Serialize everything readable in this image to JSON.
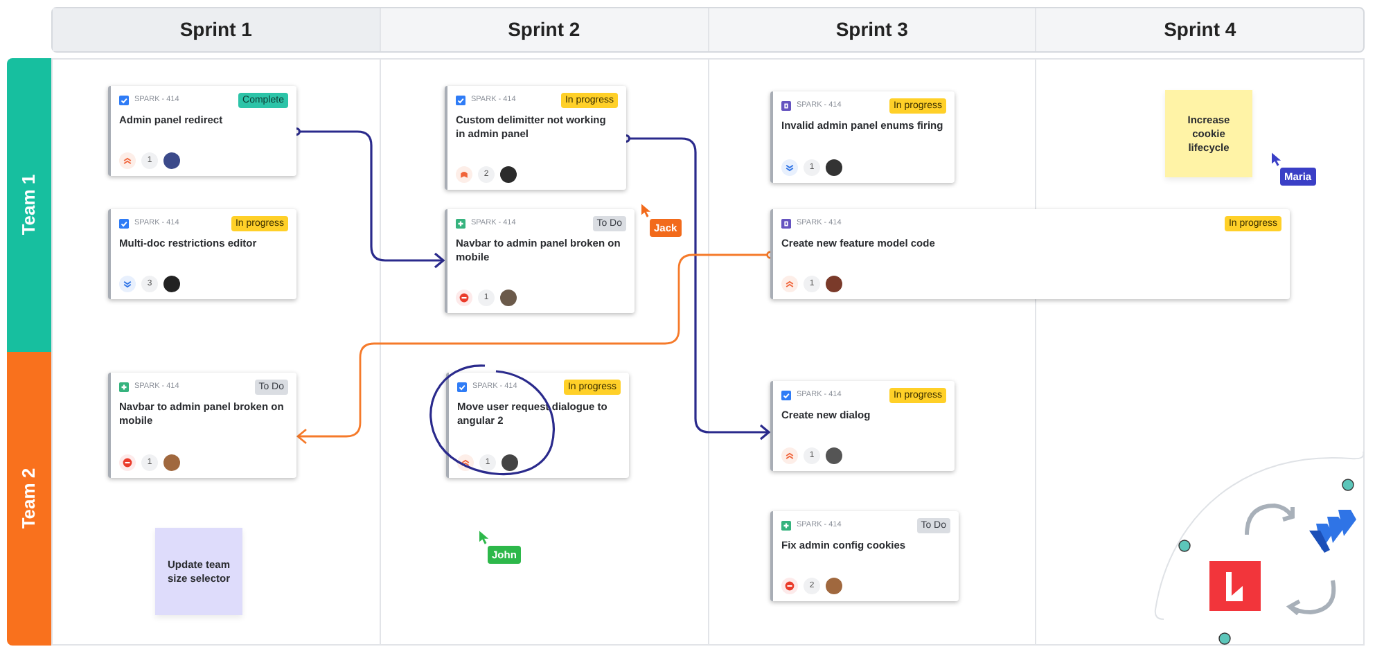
{
  "board": {
    "columns": [
      {
        "title": "Sprint 1"
      },
      {
        "title": "Sprint 2"
      },
      {
        "title": "Sprint 3"
      },
      {
        "title": "Sprint 4"
      }
    ],
    "lanes": [
      {
        "title": "Team 1",
        "color": "#17bf9f"
      },
      {
        "title": "Team 2",
        "color": "#f9711d"
      }
    ]
  },
  "cards": [
    {
      "key": "SPARK - 414",
      "title": "Admin panel redirect",
      "type": {
        "kind": "task"
      },
      "status": {
        "text": "Complete",
        "kind": "complete"
      },
      "priority": {
        "kind": "highest"
      },
      "count": "1"
    },
    {
      "key": "SPARK - 414",
      "title": "Multi-doc restrictions editor",
      "type": {
        "kind": "task"
      },
      "status": {
        "text": "In progress",
        "kind": "progress"
      },
      "priority": {
        "kind": "lowest"
      },
      "count": "3"
    },
    {
      "key": "SPARK - 414",
      "title": "Custom delimitter not working in admin panel",
      "type": {
        "kind": "task"
      },
      "status": {
        "text": "In progress",
        "kind": "progress"
      },
      "priority": {
        "kind": "critical"
      },
      "count": "2"
    },
    {
      "key": "SPARK - 414",
      "title": "Navbar to admin panel broken on mobile",
      "type": {
        "kind": "story"
      },
      "status": {
        "text": "To Do",
        "kind": "todo"
      },
      "priority": {
        "kind": "blocker"
      },
      "count": "1"
    },
    {
      "key": "SPARK - 414",
      "title": "Navbar to admin panel broken on mobile",
      "type": {
        "kind": "story"
      },
      "status": {
        "text": "To Do",
        "kind": "todo"
      },
      "priority": {
        "kind": "blocker"
      },
      "count": "1"
    },
    {
      "key": "SPARK - 414",
      "title": "Move user request dialogue to angular 2",
      "type": {
        "kind": "task"
      },
      "status": {
        "text": "In progress",
        "kind": "progress"
      },
      "priority": {
        "kind": "highest"
      },
      "count": "1"
    },
    {
      "key": "SPARK - 414",
      "title": "Invalid admin panel enums firing",
      "type": {
        "kind": "subtask"
      },
      "status": {
        "text": "In progress",
        "kind": "progress"
      },
      "priority": {
        "kind": "lowest"
      },
      "count": "1"
    },
    {
      "key": "SPARK - 414",
      "title": "Create new feature model code",
      "type": {
        "kind": "subtask"
      },
      "status": {
        "text": "In progress",
        "kind": "progress"
      },
      "priority": {
        "kind": "highest"
      },
      "count": "1"
    },
    {
      "key": "SPARK - 414",
      "title": "Create new dialog",
      "type": {
        "kind": "task"
      },
      "status": {
        "text": "In progress",
        "kind": "progress"
      },
      "priority": {
        "kind": "highest"
      },
      "count": "1"
    },
    {
      "key": "SPARK - 414",
      "title": "Fix admin config cookies",
      "type": {
        "kind": "story"
      },
      "status": {
        "text": "To Do",
        "kind": "todo"
      },
      "priority": {
        "kind": "blocker"
      },
      "count": "2"
    }
  ],
  "sticky_notes": [
    {
      "text": "Increase cookie lifecycle",
      "color": "#fff3a6"
    },
    {
      "text": "Update team size selector",
      "color": "#dedcfb"
    }
  ],
  "cursors": [
    {
      "name": "Jack",
      "color": "#f26a1b"
    },
    {
      "name": "Maria",
      "color": "#3a3fc6"
    },
    {
      "name": "John",
      "color": "#2db84a"
    }
  ]
}
